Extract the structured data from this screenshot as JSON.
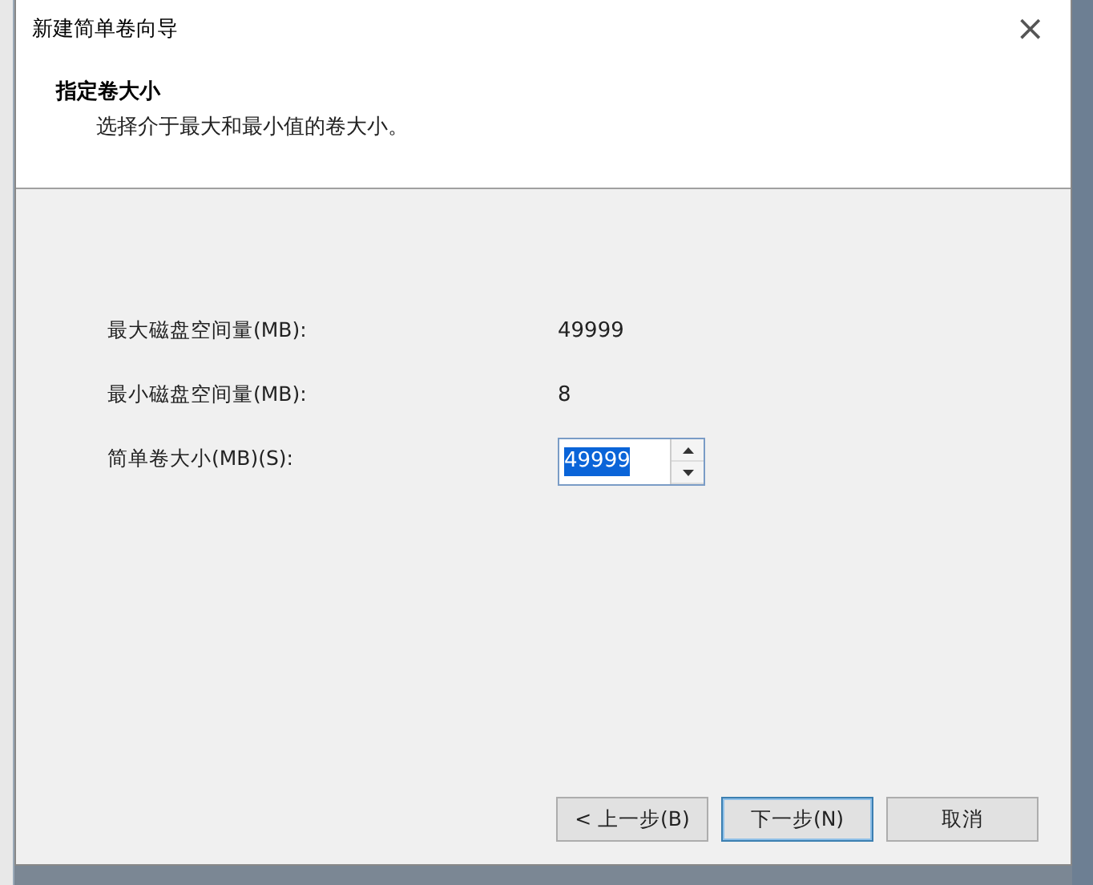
{
  "window": {
    "title": "新建简单卷向导",
    "close": "×"
  },
  "header": {
    "title": "指定卷大小",
    "subtitle": "选择介于最大和最小值的卷大小。"
  },
  "fields": [
    {
      "kind": "readout",
      "label": "最大磁盘空间量(MB):",
      "value": "49999"
    },
    {
      "kind": "readout",
      "label": "最小磁盘空间量(MB):",
      "value": "8"
    },
    {
      "kind": "spinner",
      "label": "简单卷大小(MB)(S):",
      "value": "49999"
    }
  ],
  "buttons": [
    {
      "label": "< 上一步(B)",
      "selected": false
    },
    {
      "label": "下一步(N)",
      "selected": true
    },
    {
      "label": "取消",
      "selected": false
    }
  ]
}
